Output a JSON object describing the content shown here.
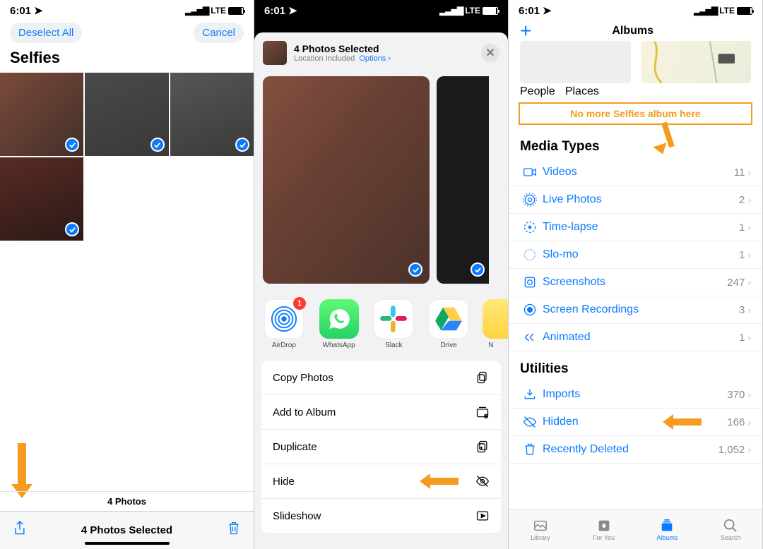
{
  "status": {
    "time": "6:01",
    "network": "LTE"
  },
  "panel1": {
    "deselect": "Deselect All",
    "cancel": "Cancel",
    "title": "Selfies",
    "count_label": "4 Photos",
    "selected_label": "4 Photos Selected"
  },
  "panel2": {
    "header_title": "4 Photos Selected",
    "header_sub": "Location Included",
    "options": "Options",
    "apps": {
      "airdrop": "AirDrop",
      "airdrop_badge": "1",
      "whatsapp": "WhatsApp",
      "slack": "Slack",
      "drive": "Drive",
      "notes": "N"
    },
    "actions": {
      "copy": "Copy Photos",
      "add": "Add to Album",
      "dup": "Duplicate",
      "hide": "Hide",
      "slide": "Slideshow"
    }
  },
  "panel3": {
    "title": "Albums",
    "people": "People",
    "places": "Places",
    "callout": "No more Selfies album here",
    "media_types_h": "Media Types",
    "utilities_h": "Utilities",
    "rows": {
      "videos": {
        "label": "Videos",
        "count": "11"
      },
      "live": {
        "label": "Live Photos",
        "count": "2"
      },
      "timelapse": {
        "label": "Time-lapse",
        "count": "1"
      },
      "slomo": {
        "label": "Slo-mo",
        "count": "1"
      },
      "screenshots": {
        "label": "Screenshots",
        "count": "247"
      },
      "recordings": {
        "label": "Screen Recordings",
        "count": "3"
      },
      "animated": {
        "label": "Animated",
        "count": "1"
      },
      "imports": {
        "label": "Imports",
        "count": "370"
      },
      "hidden": {
        "label": "Hidden",
        "count": "166"
      },
      "deleted": {
        "label": "Recently Deleted",
        "count": "1,052"
      }
    },
    "tabs": {
      "library": "Library",
      "foryou": "For You",
      "albums": "Albums",
      "search": "Search"
    }
  }
}
